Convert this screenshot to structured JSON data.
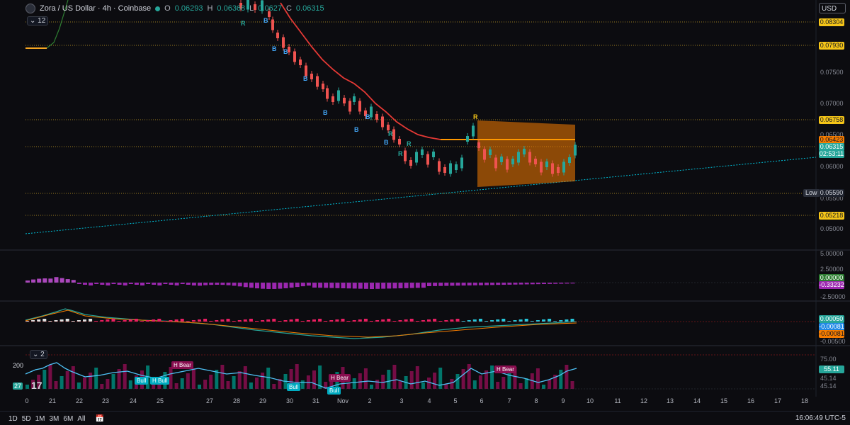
{
  "header": {
    "symbol_title": "Zora / US Dollar · 4h · Coinbase",
    "open_label": "O",
    "open_value": "0.06293",
    "high_label": "H",
    "high_value": "0.06368",
    "low_label": "L",
    "low_value": "0.0627",
    "close_label": "C",
    "close_value": "0.06315",
    "indicator_badge": "12",
    "currency": "USD"
  },
  "price_axis": {
    "ticks": [
      "0.08000",
      "0.07500",
      "0.07000",
      "0.06500",
      "0.06000",
      "0.05500",
      "0.05000"
    ],
    "labels": [
      {
        "value": "0.08304",
        "bg": "#f5c518",
        "fg": "#131722"
      },
      {
        "value": "0.07930",
        "bg": "#f5c518",
        "fg": "#131722"
      },
      {
        "value": "0.06758",
        "bg": "#f5c518",
        "fg": "#131722"
      },
      {
        "value": "0.06423",
        "bg": "#f57c00",
        "fg": "#131722"
      },
      {
        "value": "0.06315",
        "bg": "#26a69a",
        "fg": "#ffffff"
      },
      {
        "value": "02:53:11",
        "bg": "#26a69a",
        "fg": "#ffffff"
      },
      {
        "value": "0.05590",
        "bg": "#1e222d",
        "fg": "#d1d4dc"
      },
      {
        "value": "0.05218",
        "bg": "#f5c518",
        "fg": "#131722"
      }
    ],
    "low_tag": "Low"
  },
  "osc1": {
    "ticks": [
      "5.00000",
      "2.50000",
      "-2.50000"
    ],
    "label_zero": "0.00000",
    "label_value": "-0.33232"
  },
  "osc2": {
    "ticks": [
      "-0.00500"
    ],
    "label_a": "0.00050",
    "label_b": "-0.00081",
    "label_c": "-0.00081"
  },
  "osc3": {
    "badge": "2",
    "left_value": "200",
    "left_badge": "27",
    "ticks": [
      "75.00",
      "45.14",
      "45.14"
    ],
    "label_value": "55.11",
    "tags": [
      "H Bear",
      "Bull",
      "H Bull",
      "Bull",
      "H Bear",
      "Bull",
      "H Bear"
    ]
  },
  "signals": {
    "buy": "B",
    "reversal": "R"
  },
  "time_axis": [
    "0",
    "21",
    "22",
    "23",
    "24",
    "25",
    "27",
    "28",
    "29",
    "30",
    "31",
    "Nov",
    "2",
    "3",
    "4",
    "5",
    "6",
    "7",
    "8",
    "9",
    "10",
    "11",
    "12",
    "13",
    "14",
    "15",
    "16",
    "17",
    "18"
  ],
  "bottom": {
    "timeframes": [
      "1D",
      "5D",
      "1M",
      "3M",
      "6M",
      "All"
    ],
    "clock": "16:06:49 UTC-5"
  },
  "colors": {
    "bg": "#0c0c10",
    "up": "#26a69a",
    "down": "#ef5350",
    "ma": "#e53935",
    "box": "#f57c00",
    "trend": "#00bcd4",
    "hist": "#9c27b0"
  },
  "chart_data": {
    "type": "candlestick",
    "symbol": "Zora / US Dollar",
    "interval": "4h",
    "exchange": "Coinbase",
    "current_close": 0.06315,
    "levels": [
      0.08304,
      0.0793,
      0.06758,
      0.06423,
      0.0559,
      0.05218
    ],
    "ylim": [
      0.047,
      0.086
    ]
  }
}
